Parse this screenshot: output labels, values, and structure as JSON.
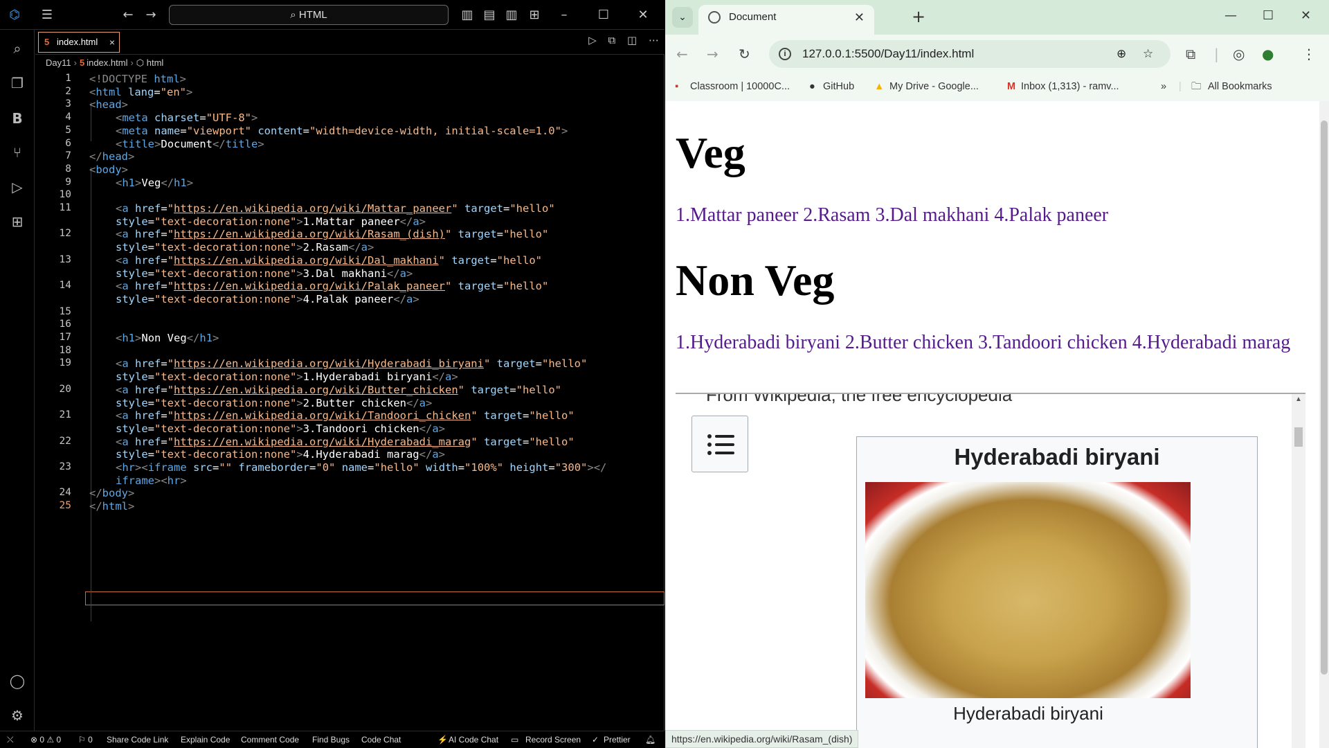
{
  "vscode": {
    "search": "HTML",
    "tab_label": "index.html",
    "tab_close": "×",
    "breadcrumb": [
      "Day11",
      "index.html",
      "html"
    ],
    "line_numbers": [
      "1",
      "2",
      "3",
      "4",
      "5",
      "6",
      "7",
      "8",
      "9",
      "10",
      "11",
      "",
      "12",
      "",
      "13",
      "",
      "14",
      "",
      "15",
      "16",
      "17",
      "18",
      "19",
      "",
      "20",
      "",
      "21",
      "",
      "22",
      "",
      "23",
      "",
      "24",
      "25"
    ],
    "code": {
      "l1": [
        "<!DOCTYPE ",
        "html",
        ">"
      ],
      "l2": [
        "<",
        "html",
        " lang",
        "=",
        "\"en\"",
        ">"
      ],
      "l3": [
        "<",
        "head",
        ">"
      ],
      "l4": [
        "<",
        "meta",
        " charset",
        "=",
        "\"UTF-8\"",
        ">"
      ],
      "l5": [
        "<",
        "meta",
        " name",
        "=",
        "\"viewport\"",
        " content",
        "=",
        "\"width=device-width, initial-scale=1.0\"",
        ">"
      ],
      "l6": [
        "<",
        "title",
        ">",
        "Document",
        "</",
        "title",
        ">"
      ],
      "l7": [
        "</",
        "head",
        ">"
      ],
      "l8": [
        "<",
        "body",
        ">"
      ],
      "l9": [
        "<",
        "h1",
        ">",
        "Veg",
        "</",
        "h1",
        ">"
      ],
      "links_veg": [
        {
          "url": "https://en.wikipedia.org/wiki/Mattar_paneer",
          "text": "1.Mattar paneer"
        },
        {
          "url": "https://en.wikipedia.org/wiki/Rasam_(dish)",
          "text": "2.Rasam"
        },
        {
          "url": "https://en.wikipedia.org/wiki/Dal_makhani",
          "text": "3.Dal makhani"
        },
        {
          "url": "https://en.wikipedia.org/wiki/Palak_paneer",
          "text": "4.Palak paneer"
        }
      ],
      "l17": [
        "<",
        "h1",
        ">",
        "Non Veg",
        "</",
        "h1",
        ">"
      ],
      "links_nonveg": [
        {
          "url": "https://en.wikipedia.org/wiki/Hyderabadi_biryani",
          "text": "1.Hyderabadi biryani"
        },
        {
          "url": "https://en.wikipedia.org/wiki/Butter_chicken",
          "text": "2.Butter chicken"
        },
        {
          "url": "https://en.wikipedia.org/wiki/Tandoori_chicken",
          "text": "3.Tandoori chicken"
        },
        {
          "url": "https://en.wikipedia.org/wiki/Hyderabadi_marag",
          "text": "4.Hyderabadi marag"
        }
      ],
      "a_open": "<a",
      "href_attr": " href",
      "target_attr": " target",
      "target_val": "\"hello\"",
      "style_attr": "style",
      "style_val": "\"text-decoration:none\"",
      "a_close": "</a>",
      "l23a": [
        "<",
        "hr",
        "><",
        "iframe",
        " src",
        "=",
        "\"\"",
        " frameborder",
        "=",
        "\"0\"",
        " name",
        "=",
        "\"hello\"",
        " width",
        "=",
        "\"100%\"",
        " height",
        "=",
        "\"300\"",
        "></"
      ],
      "l23b": [
        "iframe",
        "><",
        "hr",
        ">"
      ],
      "l24": [
        "</",
        "body",
        ">"
      ],
      "l25": [
        "</",
        "html",
        ">"
      ]
    },
    "status": {
      "errors": "⊗ 0 ⚠ 0",
      "ports": "⚐ 0",
      "items": [
        "Share Code Link",
        "Explain Code",
        "Comment Code",
        "Find Bugs",
        "Code Chat",
        "AI Code Chat",
        "Record Screen",
        "Prettier"
      ]
    }
  },
  "browser": {
    "tab_title": "Document",
    "url": "127.0.0.1:5500/Day11/index.html",
    "bookmarks": [
      "Classroom | 10000C...",
      "GitHub",
      "My Drive - Google...",
      "Inbox (1,313) - ramv...",
      "All Bookmarks"
    ],
    "page": {
      "h1_veg": "Veg",
      "veg_links": [
        "1.Mattar paneer",
        "2.Rasam",
        "3.Dal makhani",
        "4.Palak paneer"
      ],
      "h1_nonveg": "Non Veg",
      "nonveg_links": [
        "1.Hyderabadi biryani",
        "2.Butter chicken",
        "3.Tandoori chicken",
        "4.Hyderabadi marag"
      ],
      "iframe": {
        "snippet": "From Wikipedia, the free encyclopedia",
        "infobox_title": "Hyderabadi biryani",
        "caption": "Hyderabadi biryani"
      }
    },
    "status_url": "https://en.wikipedia.org/wiki/Rasam_(dish)"
  }
}
